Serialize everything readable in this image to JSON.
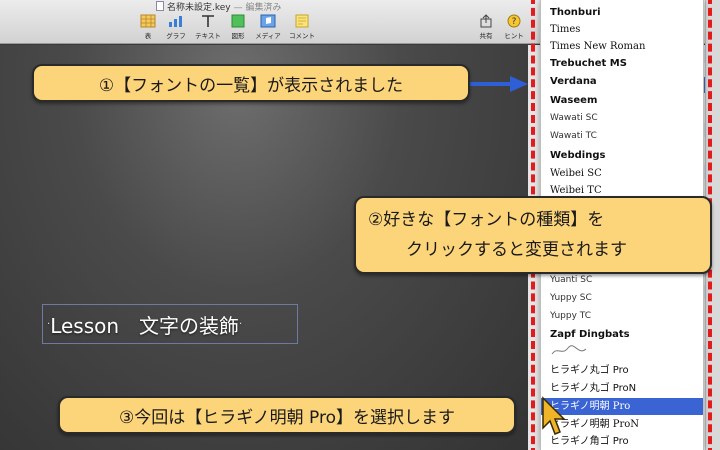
{
  "window": {
    "title": "名称未設定.key",
    "status": "— 編集済み"
  },
  "toolbar": {
    "items": [
      {
        "label": "表",
        "icon": "table-icon"
      },
      {
        "label": "グラフ",
        "icon": "chart-icon"
      },
      {
        "label": "テキスト",
        "icon": "text-icon"
      },
      {
        "label": "図形",
        "icon": "shape-icon"
      },
      {
        "label": "メディア",
        "icon": "media-icon"
      },
      {
        "label": "コメント",
        "icon": "comment-icon"
      }
    ],
    "share_label": "共有",
    "hint_label": "ヒント"
  },
  "slide": {
    "text": "Lesson　文字の装飾",
    "dot": "·"
  },
  "font_list": {
    "items": [
      {
        "name": "Thonburi",
        "style": "bold"
      },
      {
        "name": "Times",
        "style": "serif"
      },
      {
        "name": "Times New Roman",
        "style": "serif"
      },
      {
        "name": "Trebuchet MS",
        "style": "bold"
      },
      {
        "name": "Verdana",
        "style": "bold"
      },
      {
        "name": "Waseem",
        "style": "bold"
      },
      {
        "name": "Wawati SC",
        "style": "light"
      },
      {
        "name": "Wawati TC",
        "style": "light"
      },
      {
        "name": "Webdings",
        "style": "bold"
      },
      {
        "name": "Weibei SC",
        "style": "serif"
      },
      {
        "name": "Weibei TC",
        "style": "serif"
      },
      {
        "name": "Yuanti SC",
        "style": "light"
      },
      {
        "name": "Yuppy SC",
        "style": "light"
      },
      {
        "name": "Yuppy TC",
        "style": "light"
      },
      {
        "name": "Zapf Dingbats",
        "style": "bold"
      },
      {
        "name": "ヒラギノ丸ゴ Pro",
        "style": "normal"
      },
      {
        "name": "ヒラギノ丸ゴ ProN",
        "style": "normal"
      },
      {
        "name": "ヒラギノ明朝 Pro",
        "style": "serif"
      },
      {
        "name": "ヒラギノ明朝 ProN",
        "style": "serif"
      },
      {
        "name": "ヒラギノ角ゴ Pro",
        "style": "normal"
      }
    ],
    "selected": "ヒラギノ明朝 Pro"
  },
  "callouts": {
    "c1": "①【フォントの一覧】が表示されました",
    "c2_line1": "②好きな【フォントの種類】を",
    "c2_line2": "クリックすると変更されます",
    "c3": "③今回は【ヒラギノ明朝 Pro】を選択します"
  },
  "colors": {
    "callout_bg": "#fcd47a",
    "frame": "#e21c1c",
    "arrow": "#2f5fd6",
    "selection": "#3a63d3"
  }
}
